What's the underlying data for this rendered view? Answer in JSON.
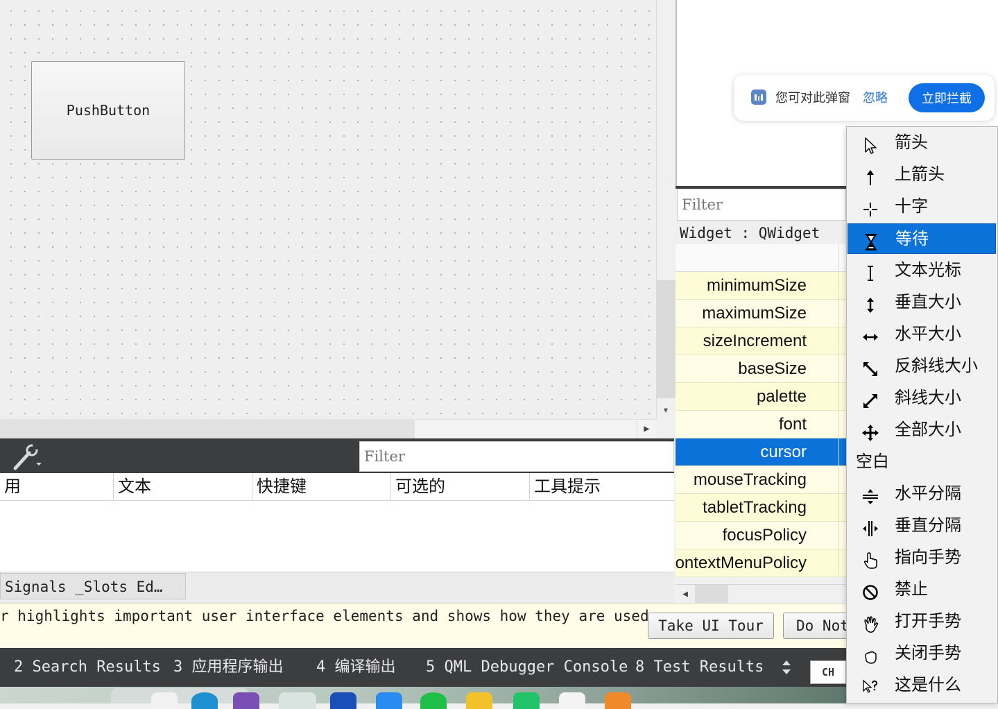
{
  "canvas": {
    "pushbutton_label": "PushButton"
  },
  "action_editor": {
    "filter_placeholder": "Filter",
    "columns": [
      "用",
      "文本",
      "快捷键",
      "可选的",
      "工具提示"
    ],
    "tab_label": "Signals _Slots Ed…"
  },
  "property_editor": {
    "filter_placeholder": "Filter",
    "object_label": "Widget : QWidget",
    "rows": [
      {
        "name": "minimumSize",
        "selected": false
      },
      {
        "name": "maximumSize",
        "selected": false
      },
      {
        "name": "sizeIncrement",
        "selected": false
      },
      {
        "name": "baseSize",
        "selected": false
      },
      {
        "name": "palette",
        "selected": false
      },
      {
        "name": "font",
        "selected": false
      },
      {
        "name": "cursor",
        "selected": true
      },
      {
        "name": "mouseTracking",
        "selected": false
      },
      {
        "name": "tabletTracking",
        "selected": false
      },
      {
        "name": "focusPolicy",
        "selected": false
      },
      {
        "name": "contextMenuPolicy",
        "selected": false
      }
    ]
  },
  "popup": {
    "message": "您可对此弹窗",
    "ignore_label": "忽略",
    "block_label": "立即拦截"
  },
  "cursor_menu": {
    "items": [
      {
        "label": "箭头",
        "icon": "arrow-cursor-icon"
      },
      {
        "label": "上箭头",
        "icon": "up-arrow-cursor-icon"
      },
      {
        "label": "十字",
        "icon": "cross-cursor-icon"
      },
      {
        "label": "等待",
        "icon": "wait-cursor-icon",
        "selected": true
      },
      {
        "label": "文本光标",
        "icon": "ibeam-cursor-icon"
      },
      {
        "label": "垂直大小",
        "icon": "size-vertical-cursor-icon"
      },
      {
        "label": "水平大小",
        "icon": "size-horizontal-cursor-icon"
      },
      {
        "label": "反斜线大小",
        "icon": "size-fdiag-cursor-icon"
      },
      {
        "label": "斜线大小",
        "icon": "size-bdiag-cursor-icon"
      },
      {
        "label": "全部大小",
        "icon": "size-all-cursor-icon"
      },
      {
        "label": "空白",
        "icon": ""
      },
      {
        "label": "水平分隔",
        "icon": "split-vertical-cursor-icon"
      },
      {
        "label": "垂直分隔",
        "icon": "split-horizontal-cursor-icon"
      },
      {
        "label": "指向手势",
        "icon": "pointing-hand-cursor-icon"
      },
      {
        "label": "禁止",
        "icon": "forbidden-cursor-icon"
      },
      {
        "label": "打开手势",
        "icon": "open-hand-cursor-icon"
      },
      {
        "label": "关闭手势",
        "icon": "closed-hand-cursor-icon"
      },
      {
        "label": "这是什么",
        "icon": "whats-this-cursor-icon"
      }
    ]
  },
  "tour": {
    "text": "r highlights important user interface elements and shows how they are used.",
    "take_tour_label": "Take UI Tour",
    "do_not_label": "Do Not"
  },
  "output_tabs": [
    {
      "label": "2  Search Results"
    },
    {
      "label": "3  应用程序输出"
    },
    {
      "label": "4  编译输出"
    },
    {
      "label": "5  QML Debugger Console"
    },
    {
      "label": "8  Test Results"
    }
  ],
  "ime": {
    "label": "CH"
  }
}
